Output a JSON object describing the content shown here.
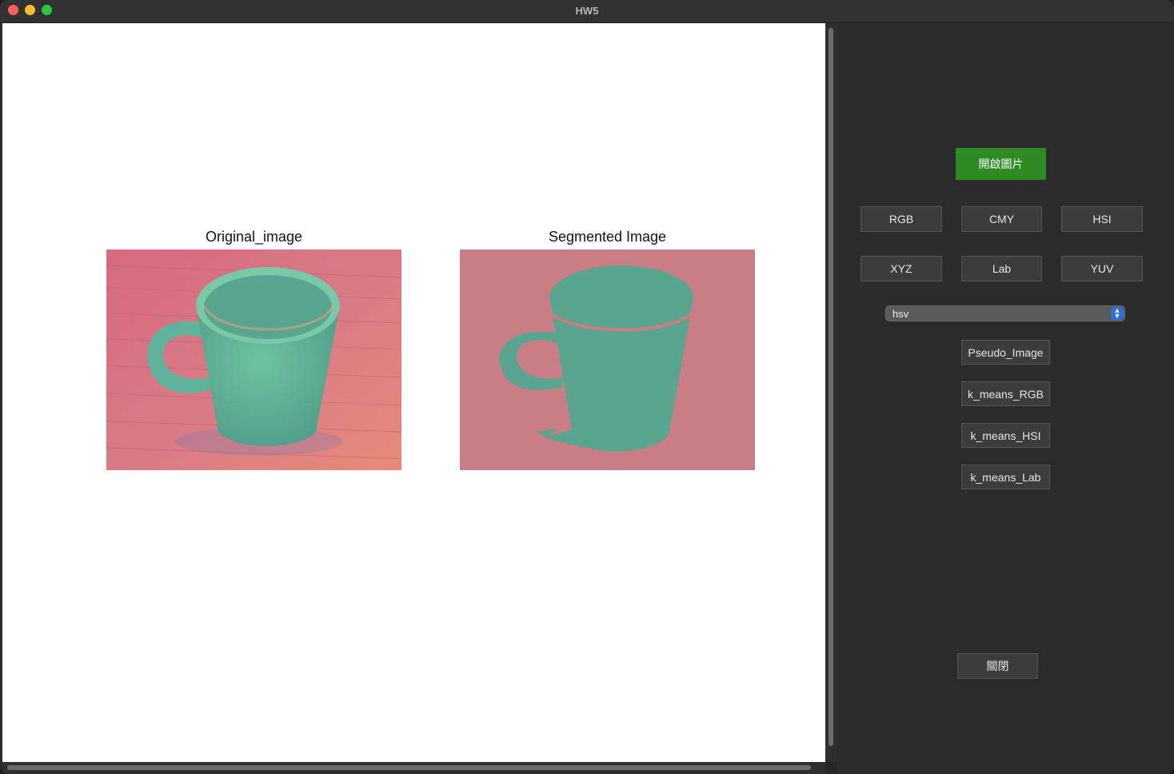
{
  "window": {
    "title": "HW5"
  },
  "plots": {
    "original_title": "Original_image",
    "segmented_title": "Segmented Image"
  },
  "panel": {
    "open_image_label": "開啟圖片",
    "color_buttons": [
      "RGB",
      "CMY",
      "HSI",
      "XYZ",
      "Lab",
      "YUV"
    ],
    "colorspace_select": {
      "value": "hsv"
    },
    "pseudo_label": "Pseudo_Image",
    "kmeans_rgb_label": "k_means_RGB",
    "kmeans_hsi_label": "k_means_HSI",
    "kmeans_lab_label": "k_means_Lab",
    "close_label": "關閉"
  },
  "colors": {
    "accent_green": "#2e8b24",
    "mug_teal": "#5aa58e",
    "segment_pink": "#c97d86",
    "select_accent": "#2f6de1"
  }
}
